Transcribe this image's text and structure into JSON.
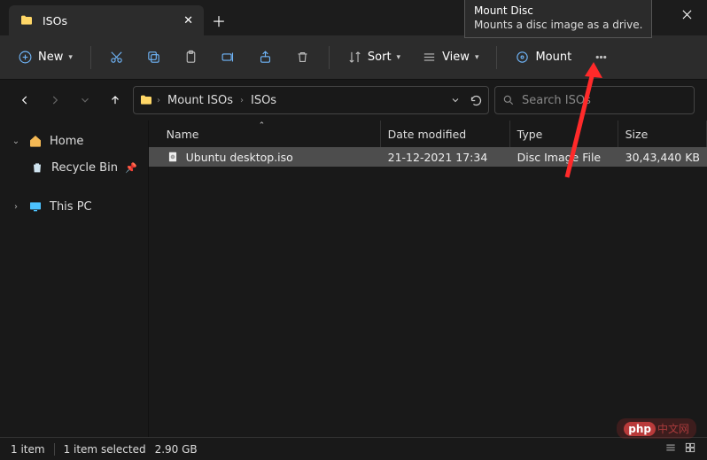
{
  "tab": {
    "title": "ISOs"
  },
  "tooltip": {
    "title": "Mount Disc",
    "desc": "Mounts a disc image as a drive."
  },
  "toolbar": {
    "new_label": "New",
    "sort_label": "Sort",
    "view_label": "View",
    "mount_label": "Mount"
  },
  "breadcrumb": {
    "seg1": "Mount ISOs",
    "seg2": "ISOs"
  },
  "search": {
    "placeholder": "Search ISOs"
  },
  "sidebar": {
    "home": "Home",
    "recycle": "Recycle Bin",
    "thispc": "This PC"
  },
  "columns": {
    "name": "Name",
    "date": "Date modified",
    "type": "Type",
    "size": "Size"
  },
  "rows": [
    {
      "name": "Ubuntu desktop.iso",
      "date": "21-12-2021 17:34",
      "type": "Disc Image File",
      "size": "30,43,440 KB",
      "selected": true
    }
  ],
  "status": {
    "count": "1 item",
    "selection": "1 item selected",
    "sel_size": "2.90 GB"
  },
  "watermark": {
    "brand": "php",
    "text": "中文网"
  }
}
